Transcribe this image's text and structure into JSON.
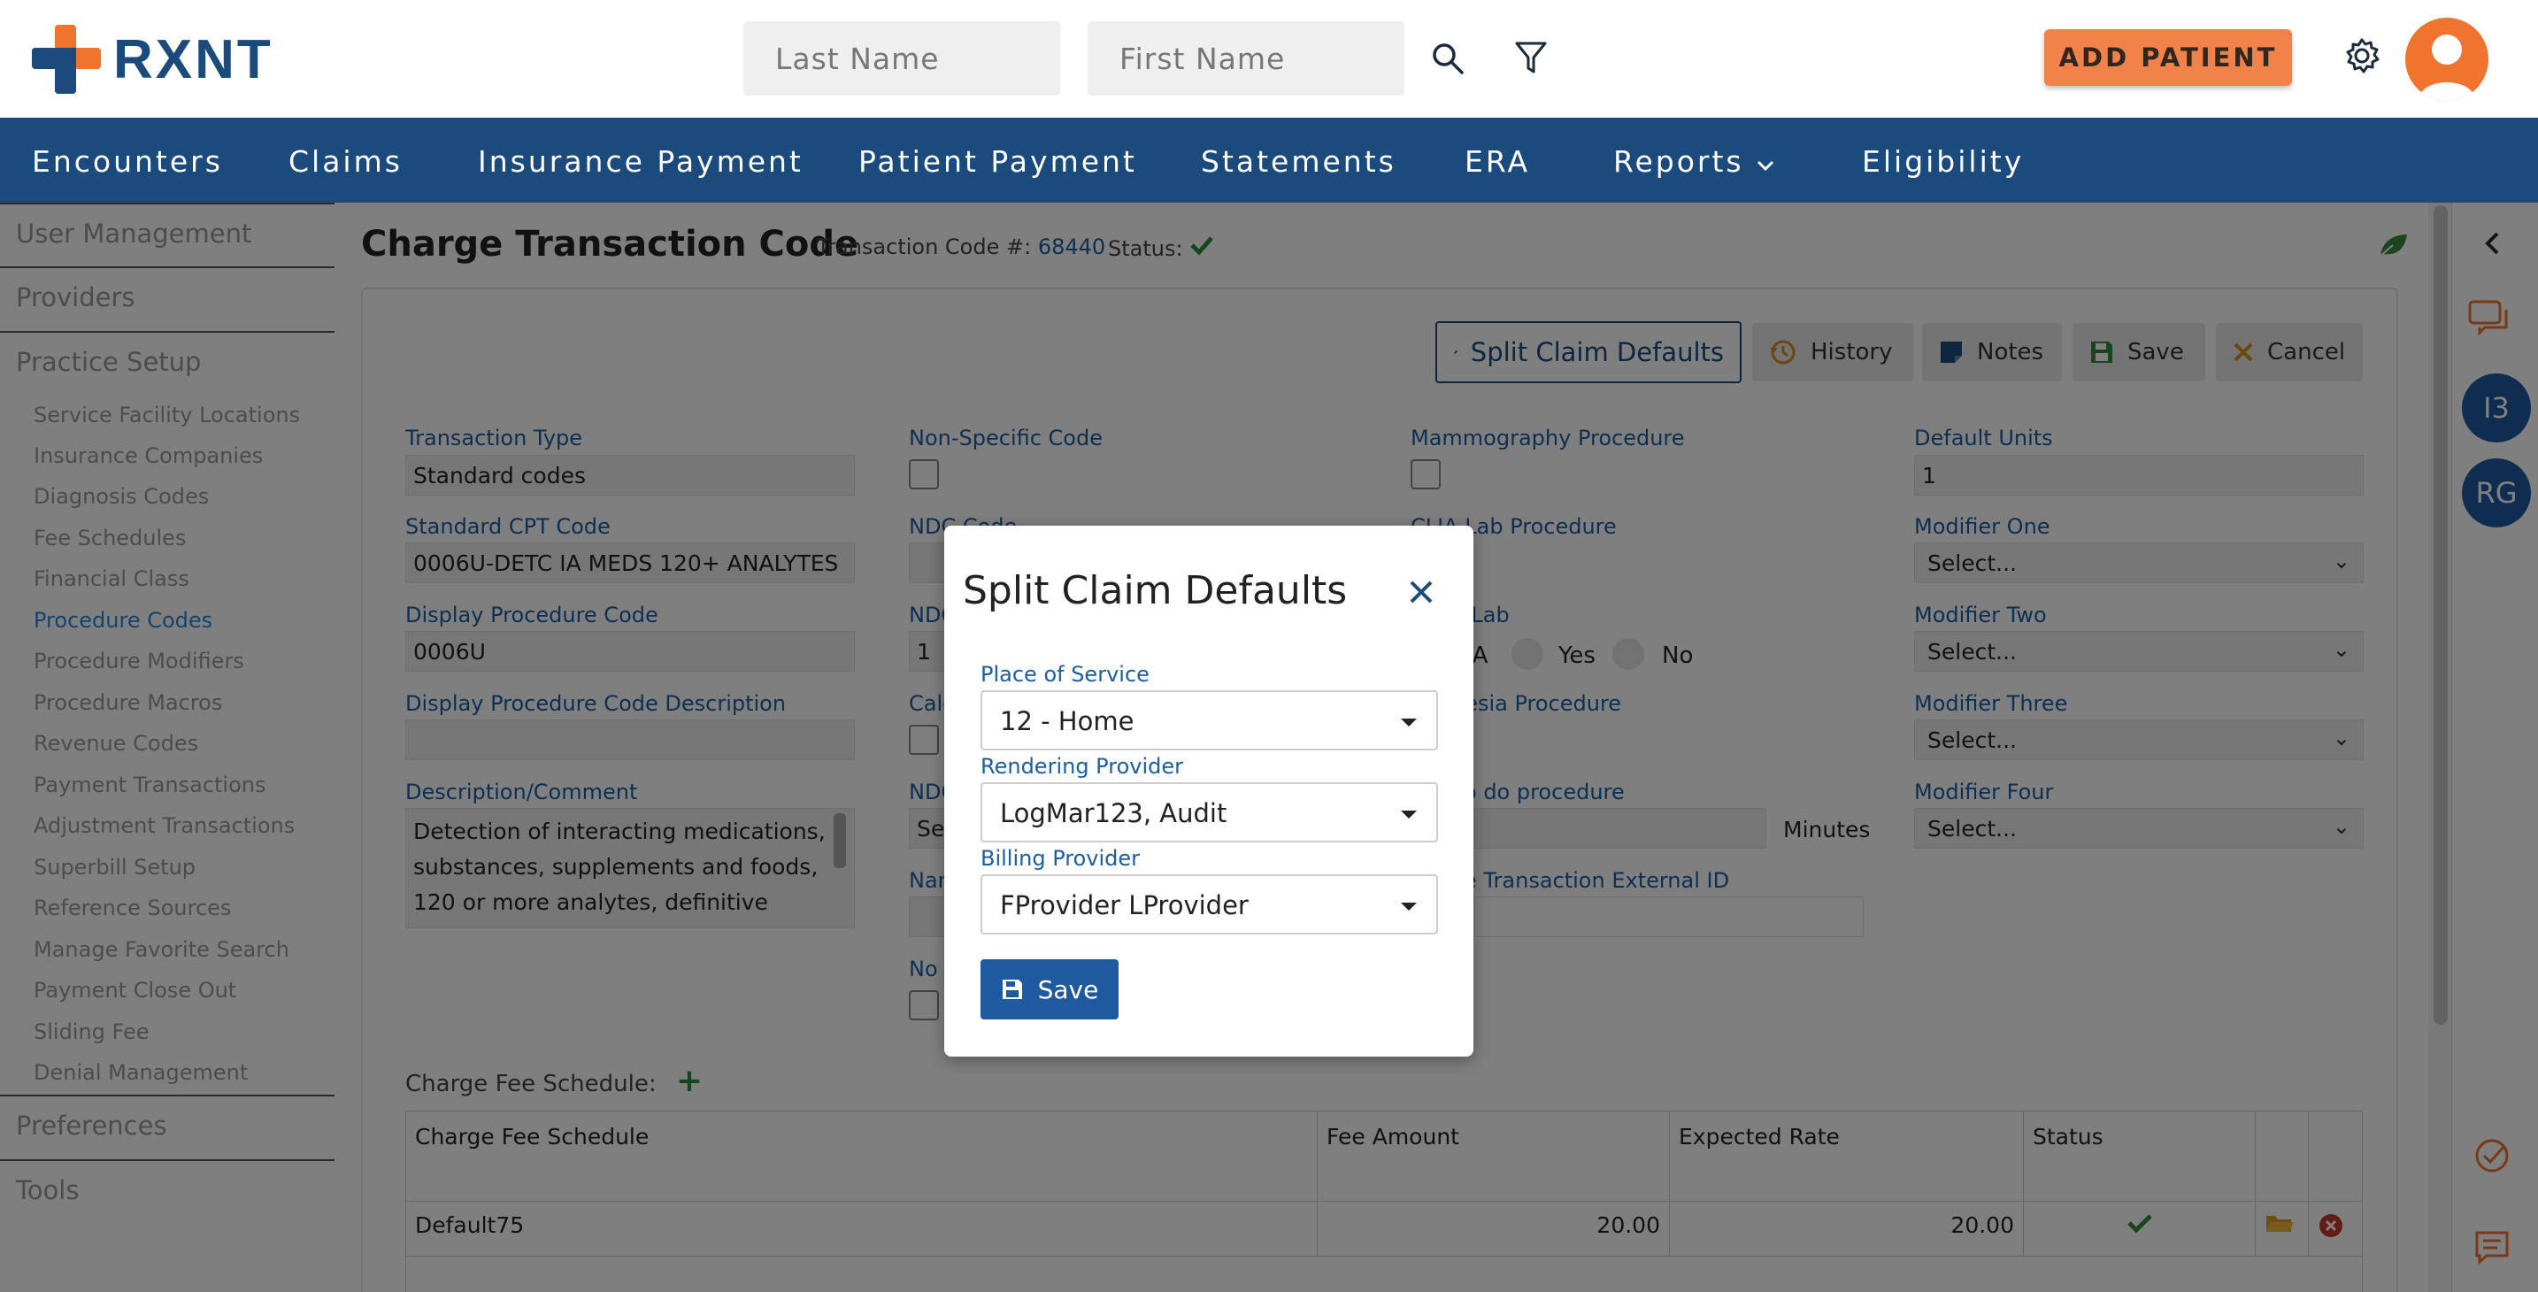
{
  "header": {
    "logo_text": "RXNT",
    "last_name_placeholder": "Last Name",
    "first_name_placeholder": "First Name",
    "add_patient_label": "ADD PATIENT"
  },
  "nav": {
    "items": [
      "Encounters",
      "Claims",
      "Insurance Payment",
      "Patient Payment",
      "Statements",
      "ERA",
      "Reports",
      "Eligibility"
    ]
  },
  "sidebar": {
    "sections": [
      "User Management",
      "Providers",
      "Practice Setup",
      "Preferences",
      "Tools"
    ],
    "items": [
      "Service Facility Locations",
      "Insurance Companies",
      "Diagnosis Codes",
      "Fee Schedules",
      "Financial Class",
      "Procedure Codes",
      "Procedure Modifiers",
      "Procedure Macros",
      "Revenue Codes",
      "Payment Transactions",
      "Adjustment Transactions",
      "Superbill Setup",
      "Reference Sources",
      "Manage Favorite Search",
      "Payment Close Out",
      "Sliding Fee",
      "Denial Management"
    ],
    "active_item": "Procedure Codes"
  },
  "page": {
    "title": "Charge Transaction Code",
    "transaction_code_label": "Transaction Code #:",
    "transaction_code_value": "68440",
    "status_label": "Status:"
  },
  "toolbar": {
    "split_claim_defaults": "Split Claim Defaults",
    "history": "History",
    "notes": "Notes",
    "save": "Save",
    "cancel": "Cancel"
  },
  "form": {
    "transaction_type_label": "Transaction Type",
    "transaction_type_value": "Standard codes",
    "standard_cpt_label": "Standard CPT Code",
    "standard_cpt_value": "0006U-DETC IA MEDS 120+ ANALYTES",
    "display_code_label": "Display Procedure Code",
    "display_code_value": "0006U",
    "display_desc_label": "Display Procedure Code Description",
    "description_label": "Description/Comment",
    "description_value": "Detection of interacting medications, substances, supplements and foods, 120 or more analytes, definitive",
    "non_specific_label": "Non-Specific Code",
    "ndc_code_label": "NDC Code",
    "ndc_label_short": "NDC",
    "ndc_units_value": "1",
    "calc_label": "Calc",
    "ndc_label2": "NDC",
    "ndc_select_partial": "Se",
    "nar_label": "Nar",
    "no_label": "No",
    "mammo_label": "Mammography Procedure",
    "clia_label": "CLIA Lab Procedure",
    "lab_label": "e Lab",
    "lab_na": "IA",
    "lab_yes": "Yes",
    "lab_no": "No",
    "anesthesia_label": "hesia Procedure",
    "todo_label": "o do procedure",
    "minutes_label": "Minutes",
    "external_id_label": "e Transaction External ID",
    "default_units_label": "Default Units",
    "default_units_value": "1",
    "modifier_one_label": "Modifier One",
    "modifier_two_label": "Modifier Two",
    "modifier_three_label": "Modifier Three",
    "modifier_four_label": "Modifier Four",
    "select_placeholder": "Select..."
  },
  "fee_schedule": {
    "label": "Charge Fee Schedule:",
    "columns": [
      "Charge Fee Schedule",
      "Fee Amount",
      "Expected Rate",
      "Status"
    ],
    "rows": [
      {
        "name": "Default75",
        "fee_amount": "20.00",
        "expected_rate": "20.00"
      }
    ]
  },
  "rail": {
    "badges": [
      "I3",
      "RG"
    ]
  },
  "modal": {
    "title": "Split Claim Defaults",
    "place_of_service_label": "Place of Service",
    "place_of_service_value": "12 - Home",
    "rendering_provider_label": "Rendering Provider",
    "rendering_provider_value": "LogMar123, Audit",
    "billing_provider_label": "Billing Provider",
    "billing_provider_value": "FProvider LProvider",
    "save_label": "Save"
  },
  "colors": {
    "brand_navy": "#1b4a7c",
    "brand_orange": "#f0732e",
    "link_blue": "#1b5fa3",
    "status_green": "#2e8b3a",
    "danger_red": "#c0392b"
  }
}
